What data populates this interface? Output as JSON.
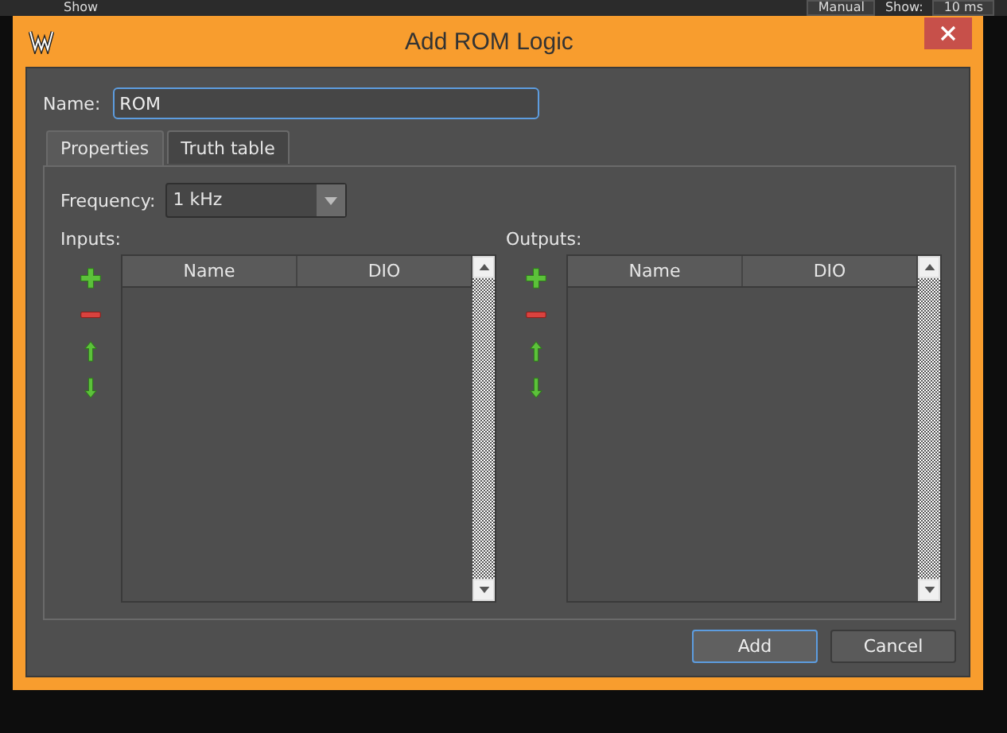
{
  "background": {
    "toolbar_label": "Show",
    "mode": "Manual",
    "show_label": "Show:",
    "show_value": "10 ms"
  },
  "window": {
    "title": "Add ROM Logic"
  },
  "name": {
    "label": "Name:",
    "value": "ROM"
  },
  "tabs": [
    {
      "label": "Properties",
      "selected": true
    },
    {
      "label": "Truth table",
      "selected": false
    }
  ],
  "frequency": {
    "label": "Frequency:",
    "value": "1 kHz"
  },
  "panels": [
    {
      "label": "Inputs:",
      "columns": [
        "Name",
        "DIO"
      ]
    },
    {
      "label": "Outputs:",
      "columns": [
        "Name",
        "DIO"
      ]
    }
  ],
  "buttons": [
    {
      "label": "Add",
      "default": true
    },
    {
      "label": "Cancel",
      "default": false
    }
  ]
}
